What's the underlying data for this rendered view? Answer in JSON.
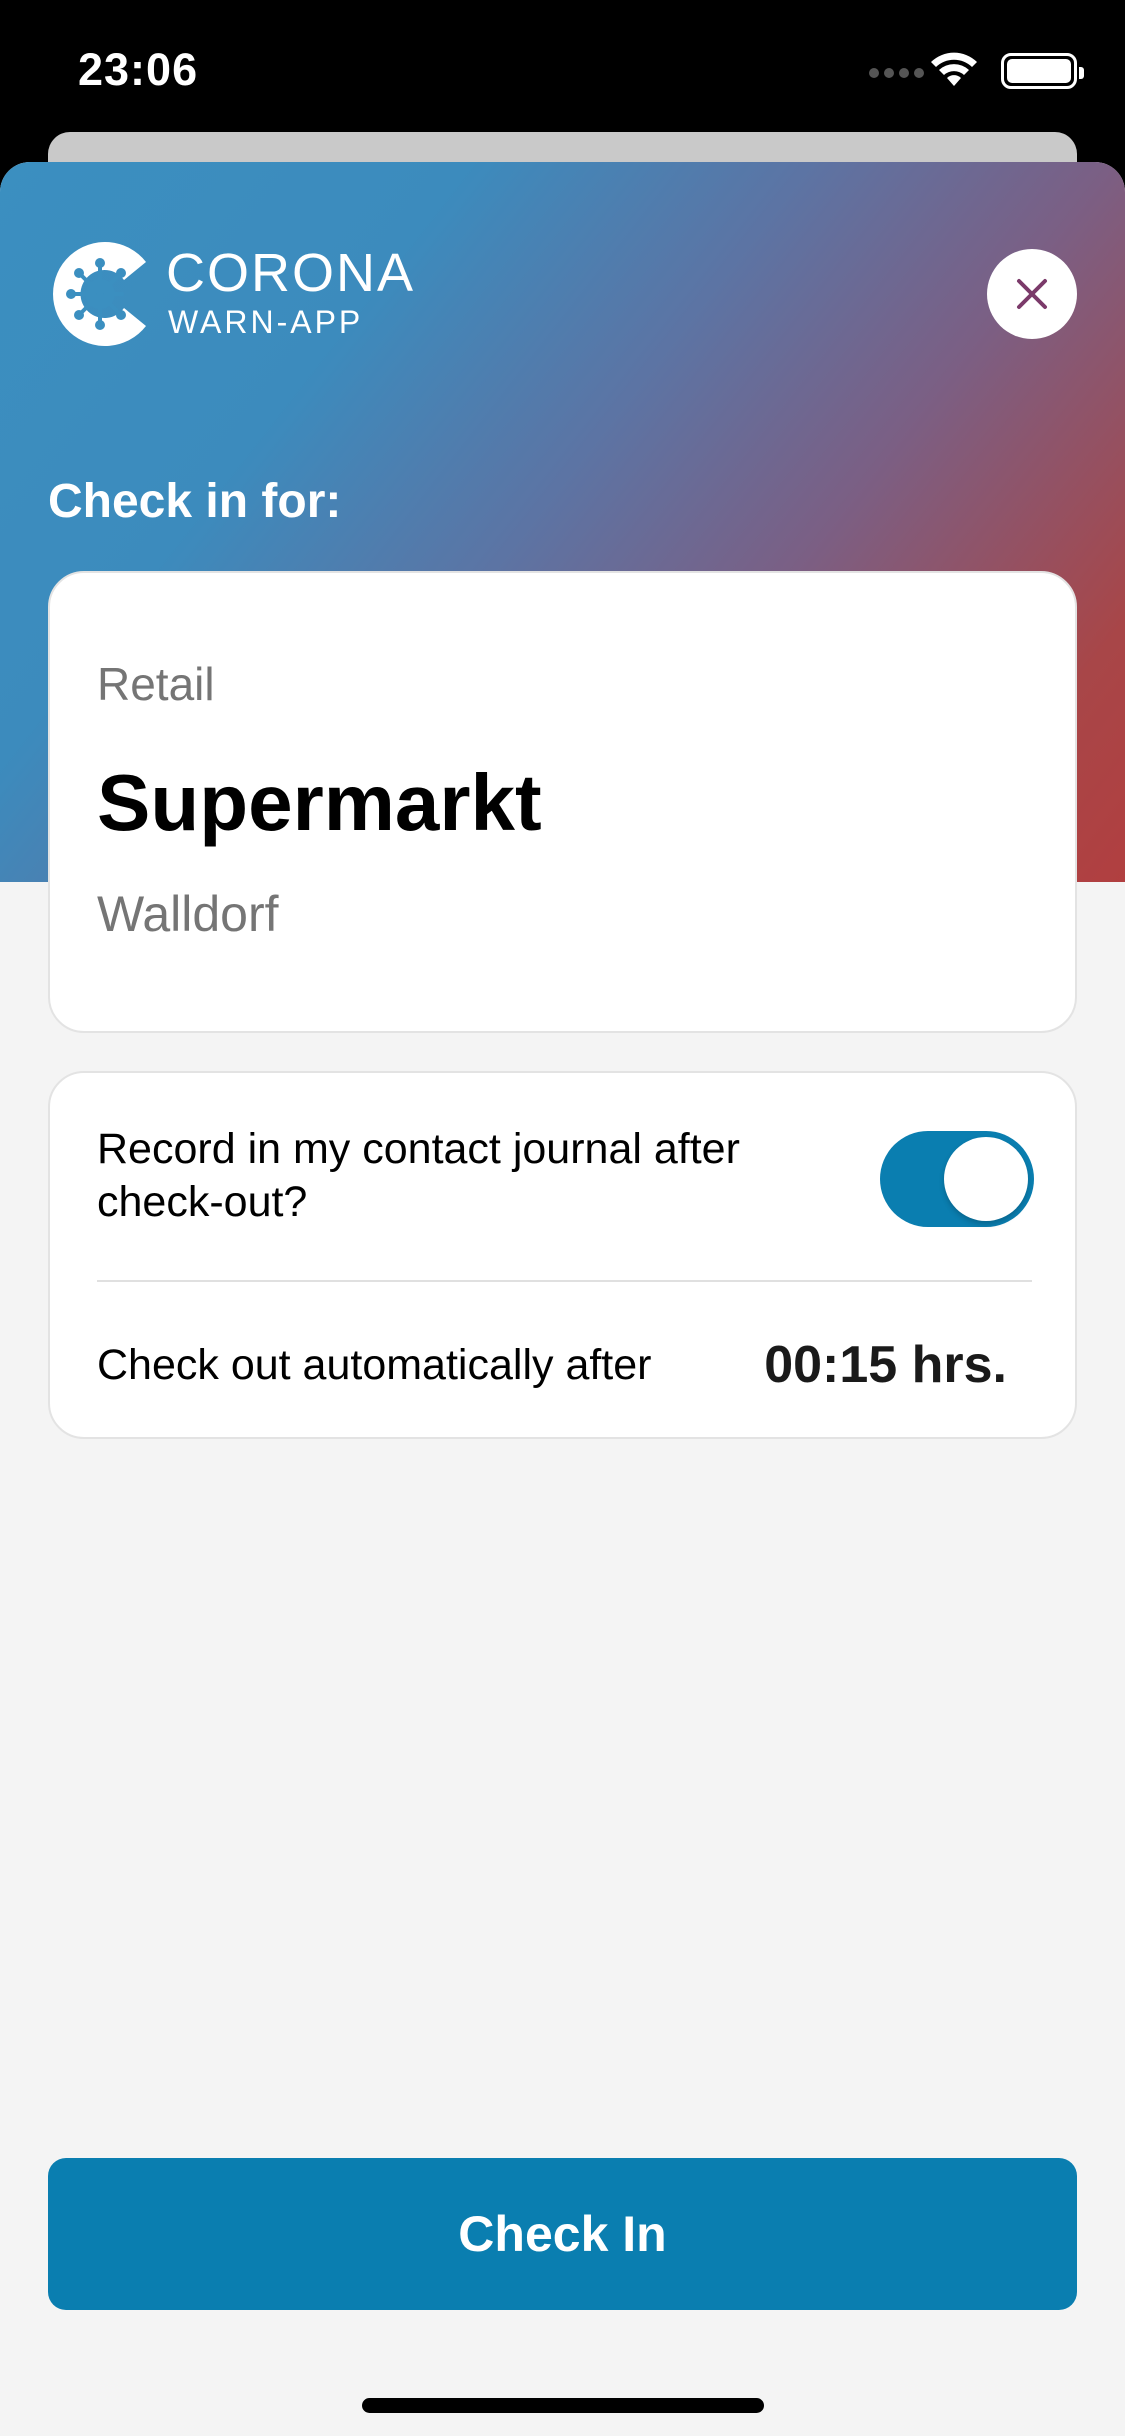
{
  "status_bar": {
    "time": "23:06"
  },
  "app": {
    "logo_title": "CORONA",
    "logo_subtitle": "WARN-APP"
  },
  "header": {
    "heading": "Check in for:"
  },
  "venue": {
    "type": "Retail",
    "name": "Supermarkt",
    "location": "Walldorf"
  },
  "options": {
    "journal_label": "Record in my contact journal after check-out?",
    "journal_enabled": true,
    "auto_checkout_label": "Check out automatically after",
    "auto_checkout_value": "00:15 hrs."
  },
  "actions": {
    "checkin_label": "Check In"
  },
  "colors": {
    "accent": "#0a7eb0",
    "gradient_start": "#3b8fc0",
    "gradient_end": "#b13f40",
    "close_icon": "#7b3a6a"
  }
}
